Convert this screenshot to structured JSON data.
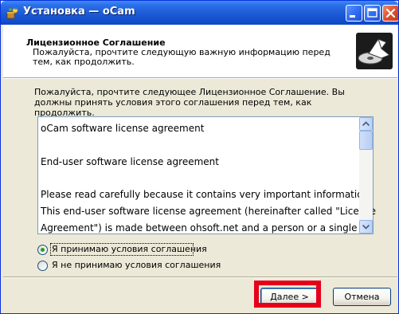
{
  "window": {
    "title": "Установка — oCam"
  },
  "header": {
    "title": "Лицензионное Соглашение",
    "description": "Пожалуйста, прочтите следующую важную информацию перед тем, как продолжить."
  },
  "intro_text": "Пожалуйста, прочтите следующее Лицензионное Соглашение. Вы должны принять условия этого соглашения перед тем, как продолжить.",
  "license": {
    "lines": [
      "oCam software license agreement",
      "",
      "End-user software license agreement",
      "",
      "Please read carefully because it contains very important information.",
      "This end-user software license agreement (hereinafter called \"License",
      "Agreement\") is made between ohsoft.net and a person or a single"
    ]
  },
  "options": {
    "accept_label": "Я принимаю условия соглашения",
    "decline_label": "Я не принимаю условия соглашения",
    "selected": "accept"
  },
  "buttons": {
    "next_label": "Далее >",
    "cancel_label": "Отмена"
  },
  "colors": {
    "titlebar": "#1b57d3",
    "highlight": "#e5001b",
    "radio_dot": "#21a121"
  }
}
